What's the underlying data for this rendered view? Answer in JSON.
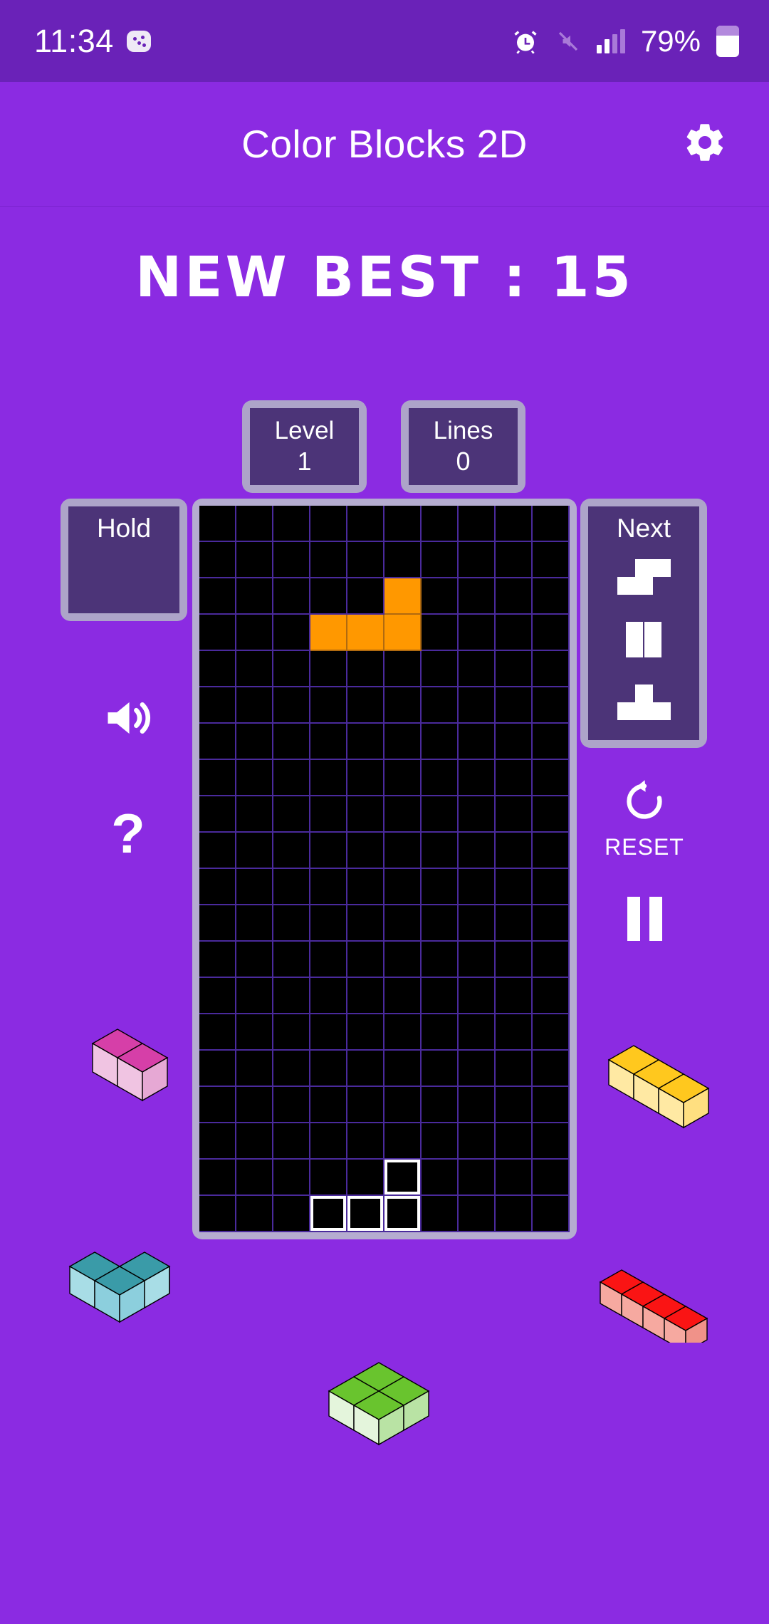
{
  "statusbar": {
    "clock": "11:34",
    "battery_percent": "79%",
    "icons": [
      "game-badge-icon",
      "alarm-icon",
      "mute-icon",
      "signal-icon",
      "battery-icon"
    ],
    "signal_bars_total": 4,
    "signal_bars_active": 2,
    "background": "#6a22b8"
  },
  "appbar": {
    "title": "Color Blocks 2D",
    "settings_icon": "gear-icon",
    "background": "#8b2be2"
  },
  "best_score": {
    "text": "NEW BEST : 15",
    "label": "NEW BEST",
    "value": 15
  },
  "stats": [
    {
      "name": "level",
      "label": "Level",
      "value": "1"
    },
    {
      "name": "lines",
      "label": "Lines",
      "value": "0"
    }
  ],
  "hold": {
    "label": "Hold",
    "piece": null
  },
  "next": {
    "label": "Next",
    "pieces": [
      {
        "name": "s-piece",
        "cells": [
          [
            1,
            0
          ],
          [
            2,
            0
          ],
          [
            0,
            1
          ],
          [
            1,
            1
          ]
        ]
      },
      {
        "name": "o-piece",
        "cells": [
          [
            0,
            0
          ],
          [
            1,
            0
          ]
        ]
      },
      {
        "name": "t-piece",
        "cells": [
          [
            1,
            0
          ],
          [
            0,
            1
          ],
          [
            1,
            1
          ],
          [
            2,
            1
          ]
        ]
      }
    ]
  },
  "board": {
    "columns": 10,
    "rows": 20,
    "cell_border_color": "#4a2a9c",
    "background": "#000000",
    "frame_color": "#b5acd0",
    "active_piece": {
      "name": "j-piece",
      "color": "#ff9800",
      "cells": [
        [
          5,
          2
        ],
        [
          3,
          3
        ],
        [
          4,
          3
        ],
        [
          5,
          3
        ]
      ]
    },
    "ghost_piece": {
      "name": "ghost-j-piece",
      "outline_color": "#ffffff",
      "cells": [
        [
          5,
          18
        ],
        [
          3,
          19
        ],
        [
          4,
          19
        ],
        [
          5,
          19
        ]
      ]
    }
  },
  "controls": {
    "sound": {
      "label": "",
      "icon": "sound-on-icon"
    },
    "help": {
      "label": "?",
      "icon": "question-mark-icon"
    },
    "reset": {
      "label": "RESET",
      "icon": "reset-circular-arrow-icon"
    },
    "pause": {
      "label": "",
      "icon": "pause-icon"
    }
  },
  "decor": [
    {
      "name": "pink-s-block",
      "top_color": "#d63fa8",
      "side_color": "#e6a8d4",
      "front_color": "#f0c4e2"
    },
    {
      "name": "teal-s-block",
      "top_color": "#3a9ba8",
      "side_color": "#a8dde6",
      "front_color": "#8ccfdd"
    },
    {
      "name": "green-o-block",
      "top_color": "#69c42e",
      "side_color": "#e4f5dc",
      "front_color": "#b9e3a4"
    },
    {
      "name": "yellow-s-block",
      "top_color": "#ffc81e",
      "side_color": "#ffe9a3",
      "front_color": "#ffdf80"
    },
    {
      "name": "red-i-block",
      "top_color": "#fa1414",
      "side_color": "#f6a9a0",
      "front_color": "#f09289"
    }
  ],
  "colors": {
    "background": "#8b2be2",
    "statusbar": "#6a22b8",
    "panel_frame": "#ada4c9",
    "panel_fill": "#4c3478",
    "accent_orange": "#ff9800"
  }
}
